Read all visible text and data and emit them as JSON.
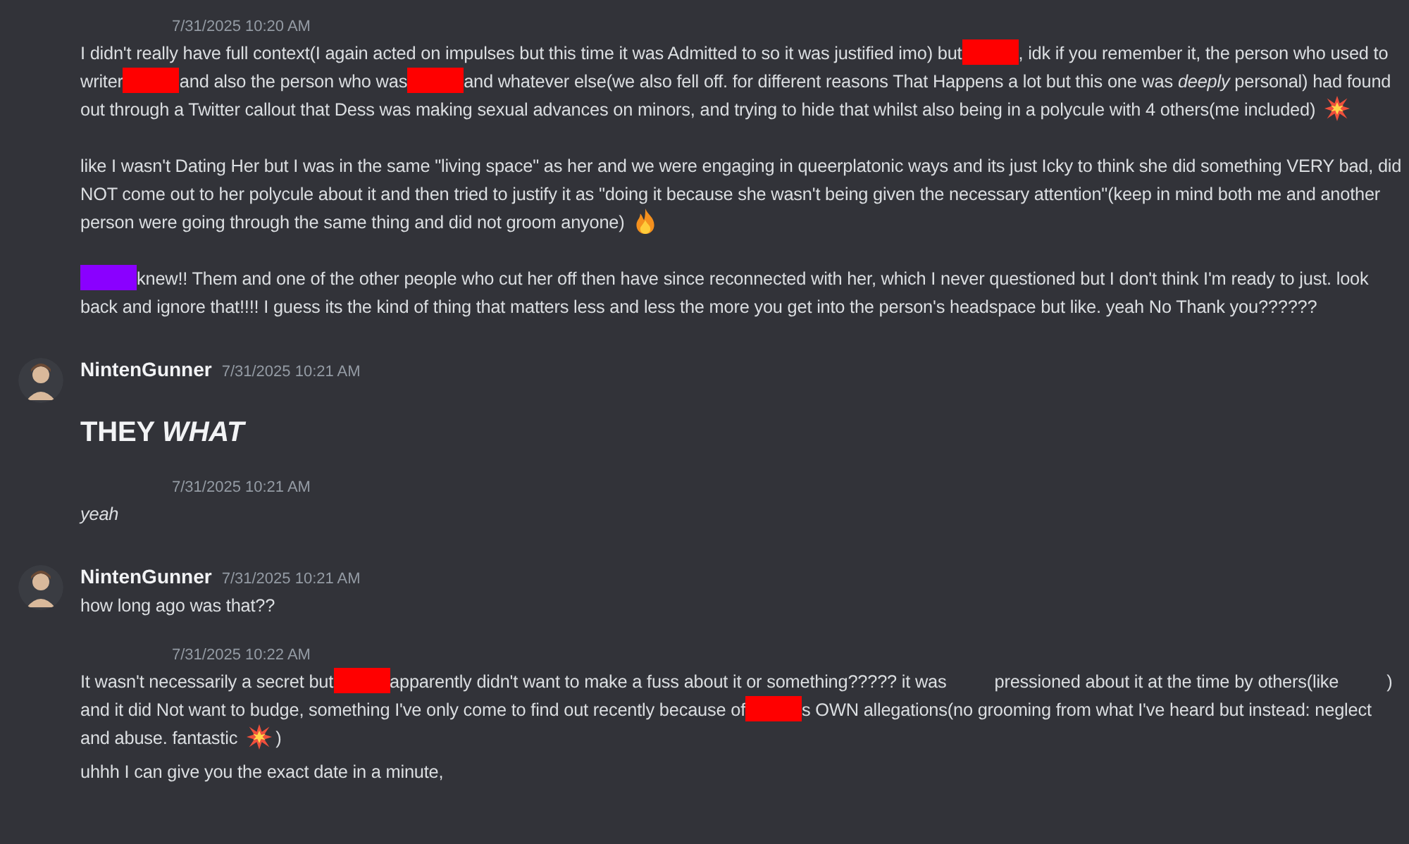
{
  "messages": [
    {
      "kind": "continuation",
      "timestamp": "7/31/2025 10:20 AM",
      "paragraphs": [
        {
          "kind": "normal",
          "segments": [
            {
              "kind": "text",
              "text": "I didn't really have full context(I again acted on impulses but this time it was Admitted to so it was justified imo) but"
            },
            {
              "kind": "redaction",
              "color": "#ff0000"
            },
            {
              "kind": "text",
              "text": ", idk if you remember it, the person who used to writer"
            },
            {
              "kind": "redaction",
              "color": "#ff0000"
            },
            {
              "kind": "text",
              "text": "and also the person who was"
            },
            {
              "kind": "redaction",
              "color": "#ff0000"
            },
            {
              "kind": "text",
              "text": "and whatever else(we also fell off. for different reasons That Happens a lot but this one was *deeply* personal) had found out through a Twitter callout that Dess was making sexual advances on minors, and trying to hide that whilst also being in a polycule with 4 others(me included)"
            },
            {
              "kind": "burst"
            }
          ]
        },
        {
          "kind": "normal",
          "segments": [
            {
              "kind": "text",
              "text": "like I wasn't Dating Her but I was in the same \"living space\" as her and we were engaging in queerplatonic ways and its just Icky to think she did something VERY bad, did NOT come out to her polycule about it and then tried to justify it as \"doing it because she wasn't being given the necessary attention\"(keep in mind both me and another person were going through the same thing and did not groom anyone)"
            },
            {
              "kind": "flame"
            }
          ]
        },
        {
          "kind": "normal",
          "segments": [
            {
              "kind": "redaction",
              "color": "#8a00ff"
            },
            {
              "kind": "text",
              "text": "knew!! Them and one of the other people who cut her off then have since reconnected with her, which I never questioned but I don't think I'm ready to just. look back and ignore that!!!! I guess its the kind of thing that matters less and less the more you get into the person's headspace but like. yeah No Thank you??????"
            }
          ]
        }
      ]
    },
    {
      "kind": "header",
      "author": "NintenGunner",
      "timestamp": "7/31/2025 10:21 AM",
      "paragraphs": [
        {
          "kind": "heading",
          "segments": [
            {
              "kind": "text",
              "text": "THEY *WHAT*"
            }
          ]
        }
      ]
    },
    {
      "kind": "continuation",
      "timestamp": "7/31/2025 10:21 AM",
      "paragraphs": [
        {
          "kind": "italic",
          "segments": [
            {
              "kind": "text",
              "text": "yeah"
            }
          ]
        }
      ]
    },
    {
      "kind": "header",
      "author": "NintenGunner",
      "timestamp": "7/31/2025 10:21 AM",
      "paragraphs": [
        {
          "kind": "normal",
          "segments": [
            {
              "kind": "text",
              "text": "how long ago was that??"
            }
          ]
        }
      ]
    },
    {
      "kind": "continuation",
      "timestamp": "7/31/2025 10:22 AM",
      "paragraphs": [
        {
          "kind": "normal",
          "segments": [
            {
              "kind": "text",
              "text": "It wasn't necessarily a secret but"
            },
            {
              "kind": "redaction",
              "color": "#ff0000"
            },
            {
              "kind": "text",
              "text": "apparently didn't want to make a fuss about it or something????? it was"
            },
            {
              "kind": "gap"
            },
            {
              "kind": "text",
              "text": "pressioned about it at the time by others(like"
            },
            {
              "kind": "gap"
            },
            {
              "kind": "text",
              "text": ") and it did Not want to budge, something I've only come to find out recently because of"
            },
            {
              "kind": "redaction",
              "color": "#ff0000"
            },
            {
              "kind": "text",
              "text": "s OWN allegations(no grooming from what I've heard but instead: neglect and abuse. fantastic"
            },
            {
              "kind": "burst"
            },
            {
              "kind": "text",
              "text": ")"
            }
          ]
        }
      ]
    },
    {
      "kind": "plain",
      "paragraphs": [
        {
          "kind": "normal",
          "segments": [
            {
              "kind": "text",
              "text": "uhhh I can give you the exact date in a minute,"
            }
          ]
        }
      ]
    }
  ]
}
